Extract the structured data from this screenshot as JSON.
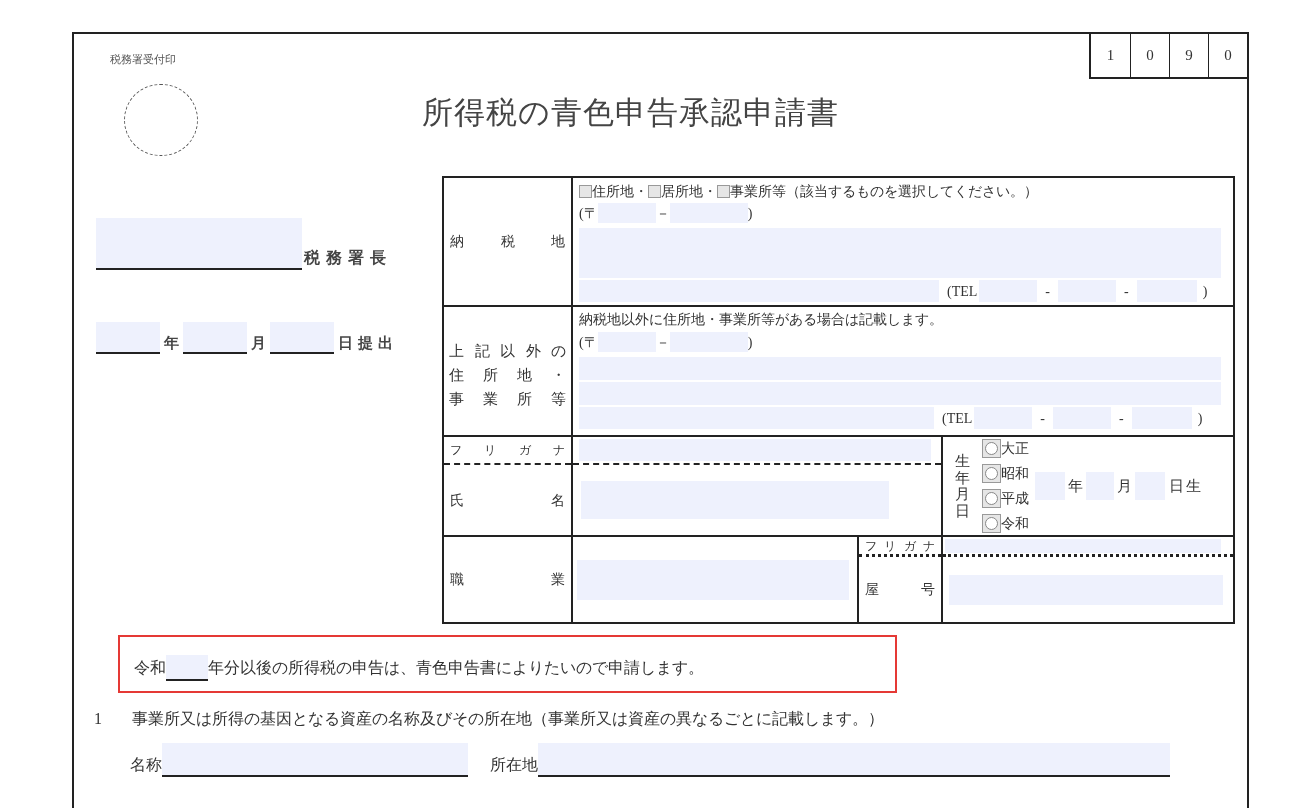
{
  "form_number": [
    "1",
    "0",
    "9",
    "0"
  ],
  "stamp_label": "税務署受付印",
  "title": "所得税の青色申告承認申請書",
  "office": {
    "suffix": "税務署長"
  },
  "submission_date": {
    "year_label": "年",
    "month_label": "月",
    "day_label": "日提出"
  },
  "tax_place": {
    "label": "納税地",
    "options": [
      {
        "label": "住所地",
        "checked": false
      },
      {
        "label": "居所地",
        "checked": false
      },
      {
        "label": "事業所等",
        "checked": false
      }
    ],
    "separator": "・",
    "note": "（該当するものを選択してください。）",
    "postal": {
      "open": "(〒",
      "dash": "－",
      "close": ")"
    },
    "tel": {
      "open": "(TEL",
      "dash1": "-",
      "dash2": "-",
      "close": ")"
    }
  },
  "other_address": {
    "label_lines": [
      "上記以外の",
      "住所地・",
      "事業所等"
    ],
    "note": "納税地以外に住所地・事業所等がある場合は記載します。",
    "postal": {
      "open": "(〒",
      "dash": "－",
      "close": ")"
    },
    "tel": {
      "open": "(TEL",
      "dash1": "-",
      "dash2": "-",
      "close": ")"
    }
  },
  "name": {
    "furigana": "フリガナ",
    "label": "氏名"
  },
  "birth": {
    "label": "生年月日",
    "eras": [
      {
        "label": "大正",
        "selected": false
      },
      {
        "label": "昭和",
        "selected": false
      },
      {
        "label": "平成",
        "selected": false
      },
      {
        "label": "令和",
        "selected": false
      }
    ],
    "year_label": "年",
    "month_label": "月",
    "day_label": "日生"
  },
  "occupation": {
    "label": "職業"
  },
  "trade_name": {
    "furigana": "フリガナ",
    "label": "屋号"
  },
  "declaration": {
    "highlighted": true,
    "prefix": "令和",
    "text": "年分以後の所得税の申告は、青色申告書によりたいので申請します。"
  },
  "section_1": {
    "number": "1",
    "text": "事業所又は所得の基因となる資産の名称及びその所在地（事業所又は資産の異なるごとに記載します。）",
    "fields": [
      {
        "label": "名称"
      },
      {
        "label": "所在地"
      }
    ]
  }
}
